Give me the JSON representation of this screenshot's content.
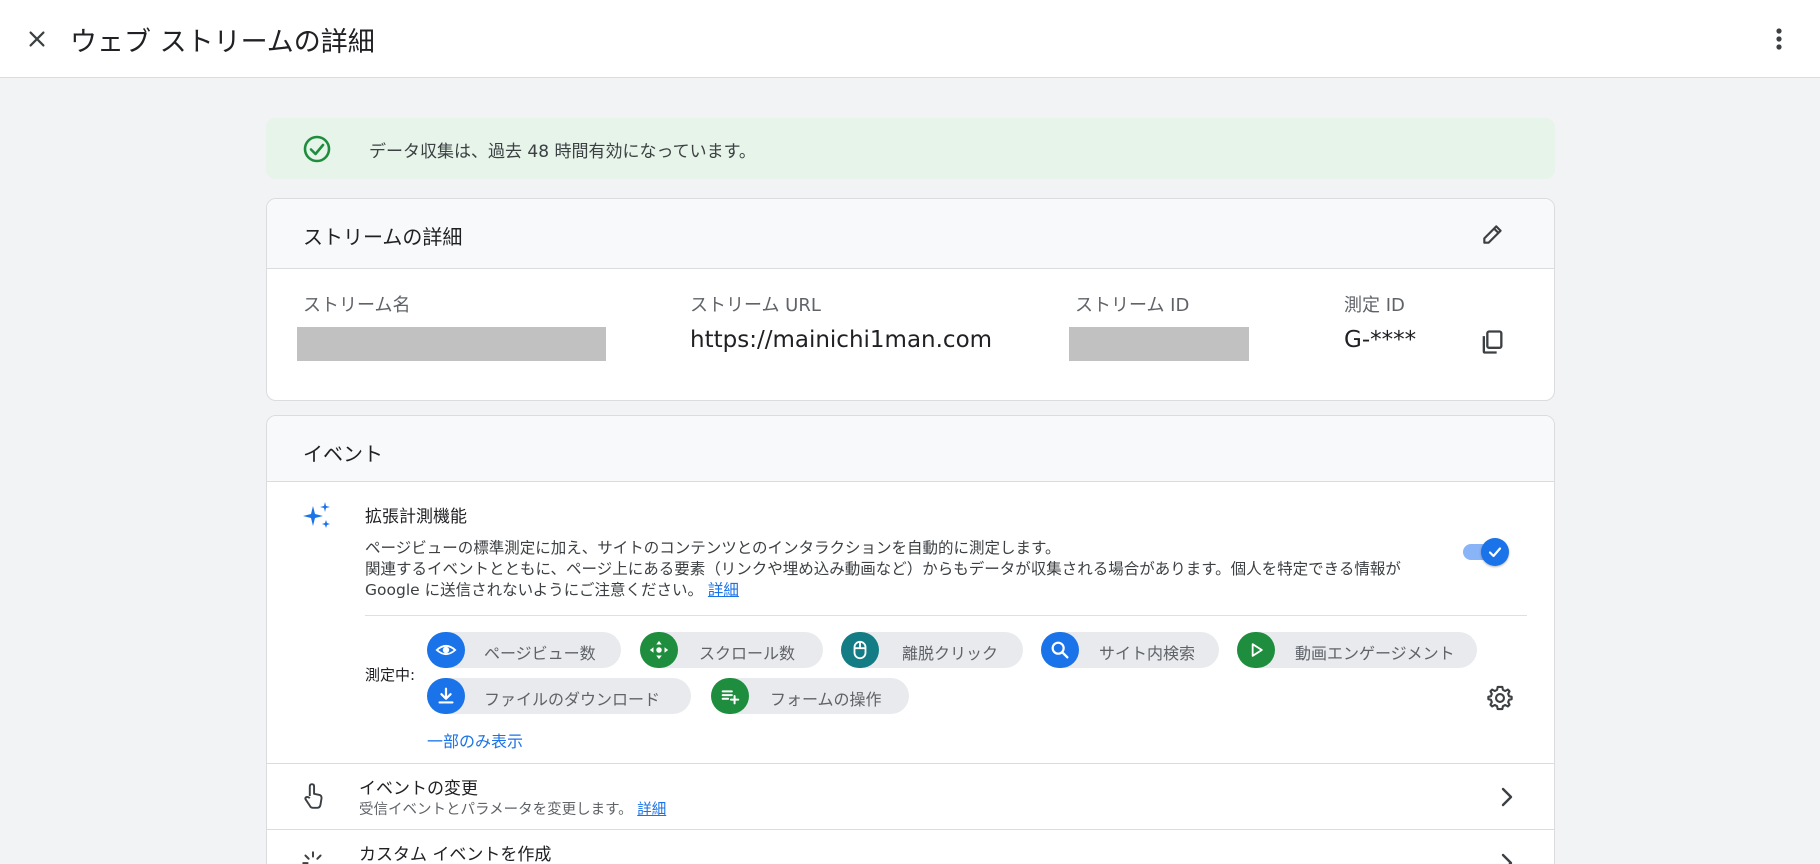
{
  "header": {
    "title": "ウェブ ストリームの詳細"
  },
  "banner": {
    "text": "データ収集は、過去 48 時間有効になっています。"
  },
  "stream_details": {
    "title": "ストリームの詳細",
    "fields": {
      "name_label": "ストリーム名",
      "url_label": "ストリーム URL",
      "url_value": "https://mainichi1man.com",
      "id_label": "ストリーム ID",
      "measurement_label": "測定 ID",
      "measurement_value": "G-****"
    }
  },
  "events": {
    "title": "イベント",
    "enhanced": {
      "title": "拡張計測機能",
      "desc_line1": "ページビューの標準測定に加え、サイトのコンテンツとのインタラクションを自動的に測定します。",
      "desc_line2": "関連するイベントとともに、ページ上にある要素（リンクや埋め込み動画など）からもデータが収集される場合があります。個人を特定できる情報が Google に送信されないようにご注意ください。",
      "link": "詳細",
      "enabled": true
    },
    "measuring_label": "測定中:",
    "chips": [
      {
        "label": "ページビュー数",
        "icon": "eye-icon"
      },
      {
        "label": "スクロール数",
        "icon": "scroll-icon"
      },
      {
        "label": "離脱クリック",
        "icon": "mouse-icon"
      },
      {
        "label": "サイト内検索",
        "icon": "search-icon"
      },
      {
        "label": "動画エンゲージメント",
        "icon": "play-icon"
      },
      {
        "label": "ファイルのダウンロード",
        "icon": "download-icon"
      },
      {
        "label": "フォームの操作",
        "icon": "form-icon"
      }
    ],
    "show_less": "一部のみ表示",
    "rows": [
      {
        "title": "イベントの変更",
        "subtitle": "受信イベントとパラメータを変更します。",
        "link": "詳細"
      },
      {
        "title": "カスタム イベントを作成",
        "subtitle": "",
        "link": ""
      }
    ]
  },
  "colors": {
    "accent": "#1a73e8",
    "success_bg": "#e6f4ea",
    "success": "#1e8e3e",
    "teal": "#137c84"
  }
}
